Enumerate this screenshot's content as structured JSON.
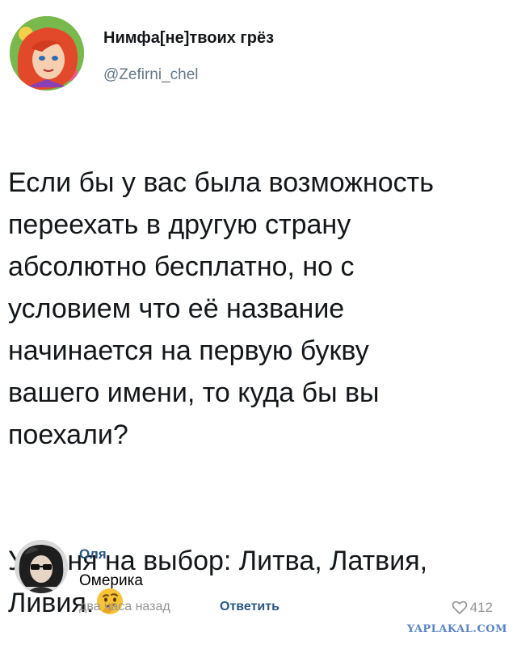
{
  "tweet": {
    "display_name": "Нимфа[не]твоих грёз",
    "handle": "@Zeﬁrni_chel",
    "body": {
      "para1": "Если бы у вас была возможность\nпереехать в другую страну\nабсолютно бесплатно, но с\nусловием что её название\nначинается на первую букву\nвашего имени, то куда бы вы\nпоехали?",
      "para2_line1": "У меня на выбор: Литва, Латвия,",
      "para2_line2": "Ливия."
    },
    "emoji_icon": "thinking-face-emoji"
  },
  "comment": {
    "author": "Оля",
    "text": "Омерика",
    "time": "два часа назад",
    "reply_label": "Ответить",
    "likes": "412"
  },
  "watermark": "YAPLAKAL.COM",
  "colors": {
    "link": "#2a5885",
    "meta": "#939393",
    "handle": "#657786",
    "text": "#14171a"
  }
}
